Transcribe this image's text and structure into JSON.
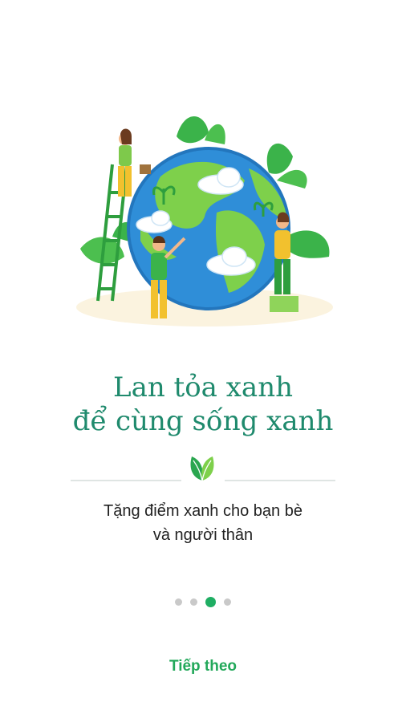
{
  "onboarding": {
    "headline_line1": "Lan tỏa xanh",
    "headline_line2": "để cùng sống xanh",
    "subtitle_line1": "Tặng điểm xanh cho bạn bè",
    "subtitle_line2": "và người thân",
    "next_label": "Tiếp theo",
    "page_count": 4,
    "current_page": 3
  },
  "colors": {
    "brand_green": "#1fae63",
    "headline_teal": "#1f8a6d",
    "dot_inactive": "#c9c9c9"
  }
}
